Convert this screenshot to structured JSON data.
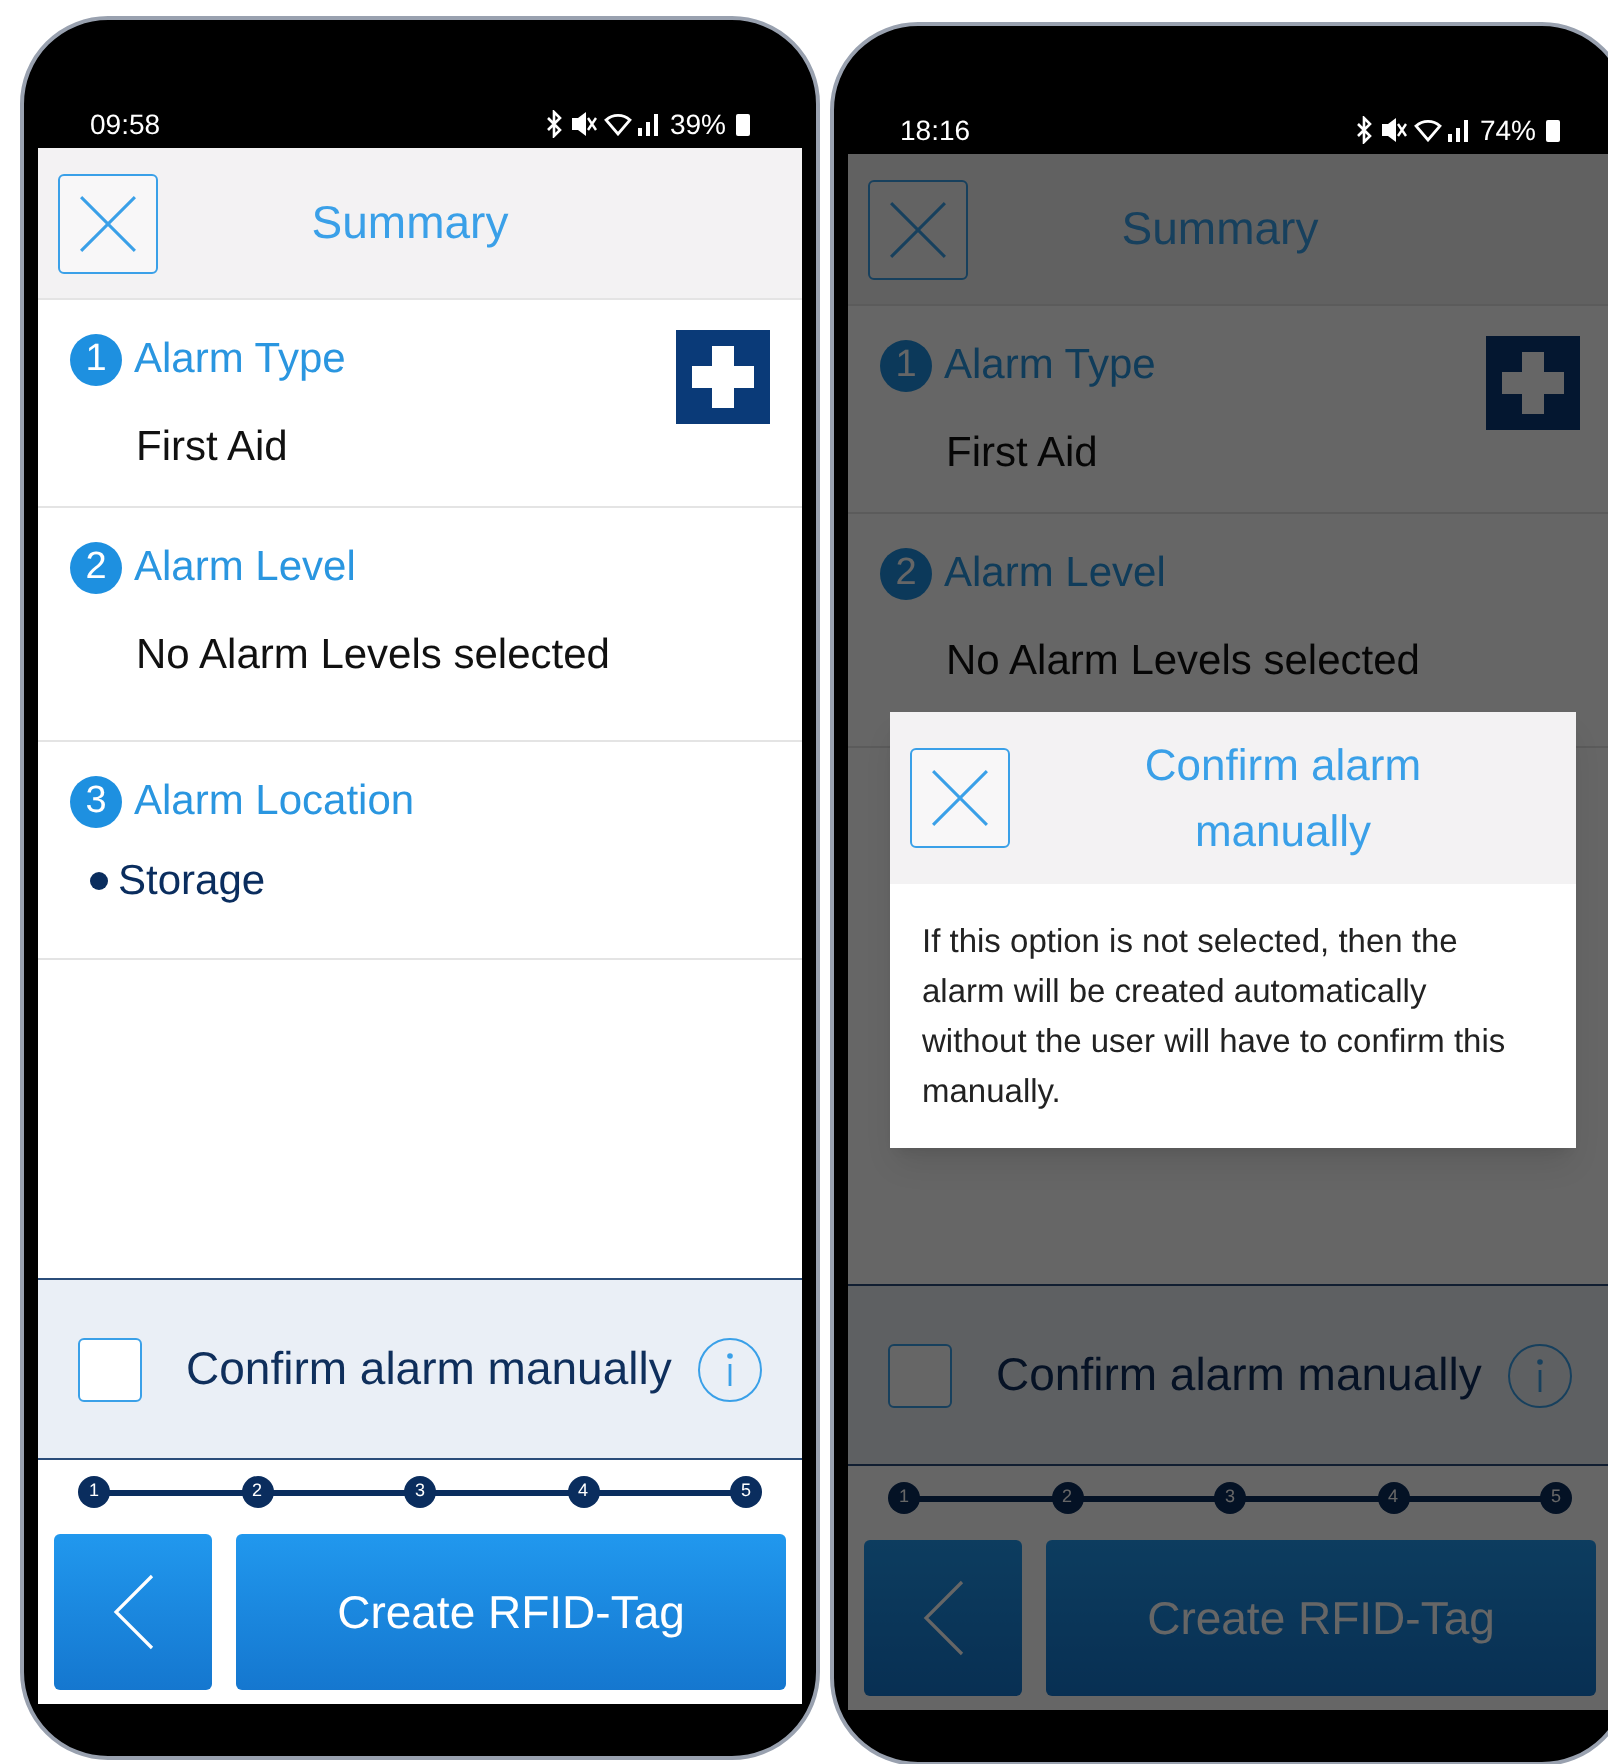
{
  "phones": [
    {
      "status_bar": {
        "time": "09:58",
        "battery": "39%"
      },
      "header": {
        "title": "Summary"
      },
      "sections": [
        {
          "number": "1",
          "title": "Alarm Type",
          "kind": "text",
          "value": "First Aid"
        },
        {
          "number": "2",
          "title": "Alarm Level",
          "kind": "text",
          "value": "No Alarm Levels selected"
        },
        {
          "number": "3",
          "title": "Alarm Location",
          "kind": "list",
          "items": [
            "Storage"
          ]
        }
      ],
      "confirm": {
        "label": "Confirm alarm manually",
        "checked": false
      },
      "steps": [
        "1",
        "2",
        "3",
        "4",
        "5"
      ],
      "primary_button": "Create RFID-Tag"
    },
    {
      "status_bar": {
        "time": "18:16",
        "battery": "74%"
      },
      "header": {
        "title": "Summary"
      },
      "sections": [
        {
          "number": "1",
          "title": "Alarm Type",
          "kind": "text",
          "value": "First Aid"
        },
        {
          "number": "2",
          "title": "Alarm Level",
          "kind": "text",
          "value": "No Alarm Levels selected"
        }
      ],
      "confirm": {
        "label": "Confirm alarm manually",
        "checked": false
      },
      "steps": [
        "1",
        "2",
        "3",
        "4",
        "5"
      ],
      "primary_button": "Create RFID-Tag",
      "dialog": {
        "title": "Confirm alarm manually",
        "text": "If this option is not selected, then the alarm will be created automatically without the user will have to confirm this manually."
      }
    }
  ]
}
